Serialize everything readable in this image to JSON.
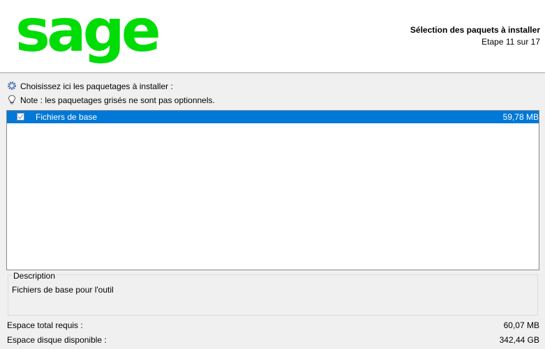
{
  "header": {
    "logo_text": "sage",
    "logo_color": "#00dc06",
    "title": "Sélection des paquets à installer",
    "step": "Etape 11 sur 17"
  },
  "instructions": {
    "choose_text": "Choisissez ici les paquetages à installer :",
    "choose_icon": "gear-icon",
    "note_text": "Note : les paquetages grisés ne sont pas optionnels.",
    "note_icon": "lightbulb-icon"
  },
  "packages": [
    {
      "name": "Fichiers de base",
      "size": "59,78 MB",
      "checked": true,
      "selected": true
    }
  ],
  "description": {
    "legend": "Description",
    "text": "Fichiers de base pour l'outil"
  },
  "footer": {
    "total_label": "Espace total requis :",
    "total_value": "60,07 MB",
    "available_label": "Espace disque disponible :",
    "available_value": "342,44 GB"
  },
  "colors": {
    "selection": "#0078d7",
    "accent": "#00dc06"
  }
}
